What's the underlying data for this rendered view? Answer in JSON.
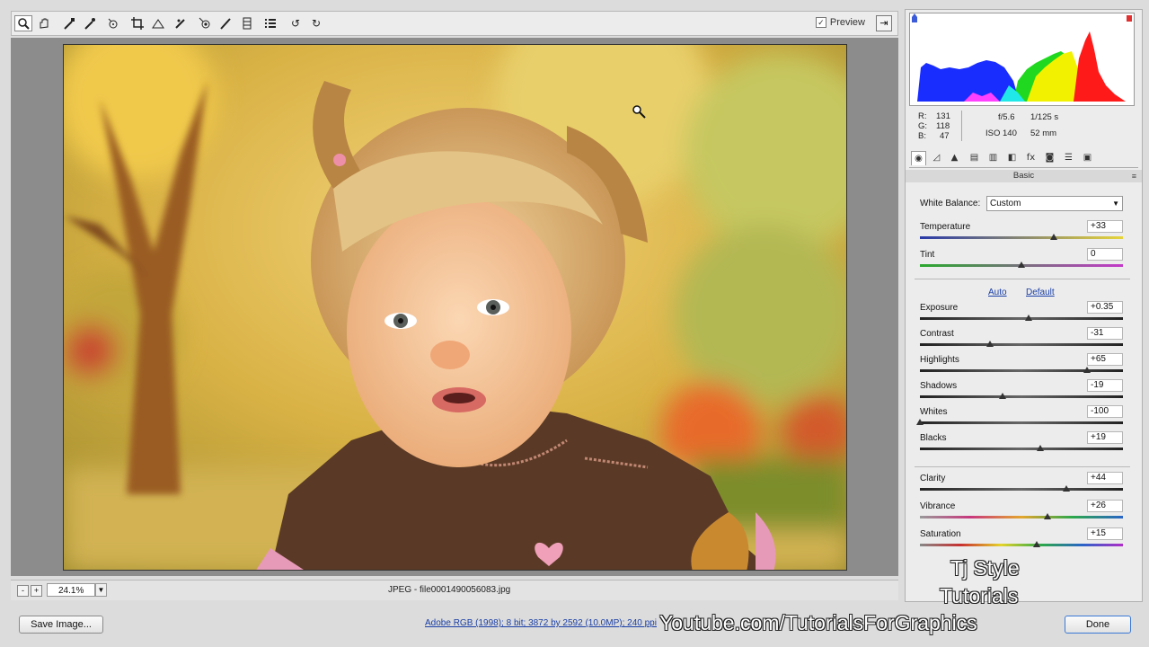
{
  "toolbar": {
    "tools": [
      {
        "name": "zoom-tool",
        "glyph": "🔍"
      },
      {
        "name": "hand-tool",
        "glyph": "✋"
      },
      {
        "name": "white-balance-tool",
        "glyph": "⁄"
      },
      {
        "name": "color-sampler-tool",
        "glyph": "✒"
      },
      {
        "name": "targeted-adjustment-tool",
        "glyph": "⊙"
      },
      {
        "name": "crop-tool",
        "glyph": "⌗"
      },
      {
        "name": "straighten-tool",
        "glyph": "◿"
      },
      {
        "name": "spot-removal-tool",
        "glyph": "⁄"
      },
      {
        "name": "red-eye-tool",
        "glyph": "◉"
      },
      {
        "name": "adjustment-brush-tool",
        "glyph": "⁄"
      },
      {
        "name": "graduated-filter-tool",
        "glyph": "▥"
      },
      {
        "name": "preferences-tool",
        "glyph": "☰"
      },
      {
        "name": "rotate-left-tool",
        "glyph": "↺"
      },
      {
        "name": "rotate-right-tool",
        "glyph": "↻"
      }
    ],
    "preview_label": "Preview",
    "preview_checked": "✓"
  },
  "status": {
    "zoom_value": "24.1%",
    "zoom_out": "-",
    "zoom_in": "+",
    "file_label": "JPEG  -  file0001490056083.jpg"
  },
  "readouts": {
    "r_label": "R:",
    "r_value": "131",
    "g_label": "G:",
    "g_value": "118",
    "b_label": "B:",
    "b_value": "47",
    "aperture": "f/5.6",
    "shutter": "1/125 s",
    "iso": "ISO 140",
    "focal": "52 mm"
  },
  "panel": {
    "section_title": "Basic",
    "white_balance_label": "White Balance:",
    "white_balance_value": "Custom",
    "auto_label": "Auto",
    "default_label": "Default",
    "sliders": [
      {
        "key": "temperature",
        "label": "Temperature",
        "value": "+33",
        "pos": 0.66
      },
      {
        "key": "tint",
        "label": "Tint",
        "value": "0",
        "pos": 0.5
      },
      {
        "key": "exposure",
        "label": "Exposure",
        "value": "+0.35",
        "pos": 0.535
      },
      {
        "key": "contrast",
        "label": "Contrast",
        "value": "-31",
        "pos": 0.345
      },
      {
        "key": "highlights",
        "label": "Highlights",
        "value": "+65",
        "pos": 0.825
      },
      {
        "key": "shadows",
        "label": "Shadows",
        "value": "-19",
        "pos": 0.405
      },
      {
        "key": "whites",
        "label": "Whites",
        "value": "-100",
        "pos": 0.0
      },
      {
        "key": "blacks",
        "label": "Blacks",
        "value": "+19",
        "pos": 0.595
      },
      {
        "key": "clarity",
        "label": "Clarity",
        "value": "+44",
        "pos": 0.72
      },
      {
        "key": "vibrance",
        "label": "Vibrance",
        "value": "+26",
        "pos": 0.63
      },
      {
        "key": "saturation",
        "label": "Saturation",
        "value": "+15",
        "pos": 0.575
      }
    ]
  },
  "bottom": {
    "save_image_label": "Save Image...",
    "workflow_label": "Adobe RGB (1998); 8 bit; 3872 by 2592 (10.0MP); 240 ppi",
    "done_label": "Done"
  },
  "watermark": {
    "line1": "Tj Style",
    "line2": "Tutorials",
    "line3": "Youtube.com/TutorialsForGraphics"
  },
  "colors": {
    "accent_link": "#1a3fa6",
    "done_border": "#3a78d6"
  }
}
